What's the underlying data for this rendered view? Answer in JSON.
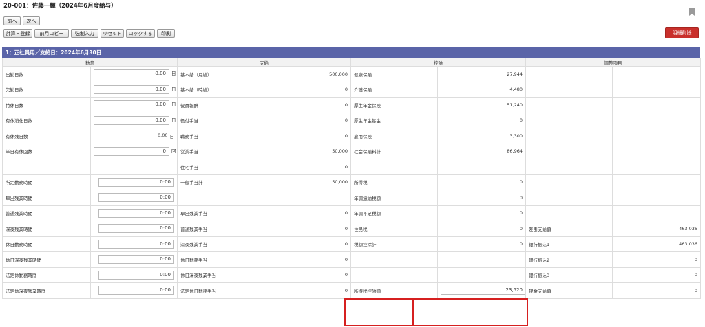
{
  "header": {
    "title": "20-001：佐藤一輝（2024年6月度給与）"
  },
  "nav": {
    "prev": "前へ",
    "next": "次へ"
  },
  "toolbar": {
    "calc": "計算・登録",
    "copy": "前月コピー",
    "force": "強制入力",
    "reset": "リセット",
    "lock": "ロックする",
    "print": "印刷"
  },
  "delete_label": "明細削除",
  "section": {
    "title": "1：正社員用／支給日：2024年6月30日"
  },
  "columns": {
    "attendance": "勤怠",
    "pay": "支給",
    "deduct": "控除",
    "adjust": "調整項目"
  },
  "rows": [
    {
      "a_label": "出勤日数",
      "a_val": "0.00",
      "a_unit": "日",
      "p_label": "基本給（月給）",
      "p_val": "500,000",
      "d_label": "健康保険",
      "d_val": "27,944",
      "j_label": "",
      "j_val": ""
    },
    {
      "a_label": "欠勤日数",
      "a_val": "0.00",
      "a_unit": "日",
      "p_label": "基本給（時給）",
      "p_val": "0",
      "d_label": "介護保険",
      "d_val": "4,480",
      "j_label": "",
      "j_val": ""
    },
    {
      "a_label": "特休日数",
      "a_val": "0.00",
      "a_unit": "日",
      "p_label": "役員報酬",
      "p_val": "0",
      "d_label": "厚生年金保険",
      "d_val": "51,240",
      "j_label": "",
      "j_val": ""
    },
    {
      "a_label": "有休消化日数",
      "a_val": "0.00",
      "a_unit": "日",
      "p_label": "役付手当",
      "p_val": "0",
      "d_label": "厚生年金基金",
      "d_val": "0",
      "j_label": "",
      "j_val": ""
    },
    {
      "a_label": "有休残日数",
      "a_val": "0.00",
      "a_unit": "日",
      "p_label": "職務手当",
      "p_val": "0",
      "d_label": "雇用保険",
      "d_val": "3,300",
      "j_label": "",
      "j_val": ""
    },
    {
      "a_label": "半日有休回数",
      "a_val": "0",
      "a_unit": "回",
      "p_label": "営業手当",
      "p_val": "50,000",
      "d_label": "社会保険料計",
      "d_val": "86,964",
      "j_label": "",
      "j_val": ""
    },
    {
      "a_label": "",
      "a_val": "",
      "a_unit": "",
      "p_label": "住宅手当",
      "p_val": "0",
      "d_label": "",
      "d_val": "",
      "j_label": "",
      "j_val": ""
    },
    {
      "a_label": "所定勤務時間",
      "a_val": "0:00",
      "a_unit": "",
      "p_label": "一般手当計",
      "p_val": "50,000",
      "d_label": "所得税",
      "d_val": "0",
      "j_label": "",
      "j_val": ""
    },
    {
      "a_label": "早出残業時間",
      "a_val": "0:00",
      "a_unit": "",
      "p_label": "",
      "p_val": "",
      "d_label": "年調過納税額",
      "d_val": "0",
      "j_label": "",
      "j_val": ""
    },
    {
      "a_label": "普通残業時間",
      "a_val": "0:00",
      "a_unit": "",
      "p_label": "早出残業手当",
      "p_val": "0",
      "d_label": "年調不足税額",
      "d_val": "0",
      "j_label": "",
      "j_val": ""
    },
    {
      "a_label": "深夜残業時間",
      "a_val": "0:00",
      "a_unit": "",
      "p_label": "普通残業手当",
      "p_val": "0",
      "d_label": "住民税",
      "d_val": "0",
      "j_label": "差引支給額",
      "j_val": "463,036"
    },
    {
      "a_label": "休日勤務時間",
      "a_val": "0:00",
      "a_unit": "",
      "p_label": "深夜残業手当",
      "p_val": "0",
      "d_label": "税額控除計",
      "d_val": "0",
      "j_label": "銀行振込1",
      "j_val": "463,036"
    },
    {
      "a_label": "休日深夜残業時間",
      "a_val": "0:00",
      "a_unit": "",
      "p_label": "休日勤務手当",
      "p_val": "0",
      "d_label": "",
      "d_val": "",
      "j_label": "銀行振込2",
      "j_val": "0"
    },
    {
      "a_label": "法定休勤務時間",
      "a_val": "0:00",
      "a_unit": "",
      "p_label": "休日深夜残業手当",
      "p_val": "0",
      "d_label": "",
      "d_val": "",
      "j_label": "銀行振込3",
      "j_val": "0"
    },
    {
      "a_label": "法定休深夜残業時間",
      "a_val": "0:00",
      "a_unit": "",
      "p_label": "法定休日勤務手当",
      "p_val": "0",
      "d_label": "所得税控除額",
      "d_val": "23,520",
      "j_label": "現金支給額",
      "j_val": "0"
    }
  ]
}
